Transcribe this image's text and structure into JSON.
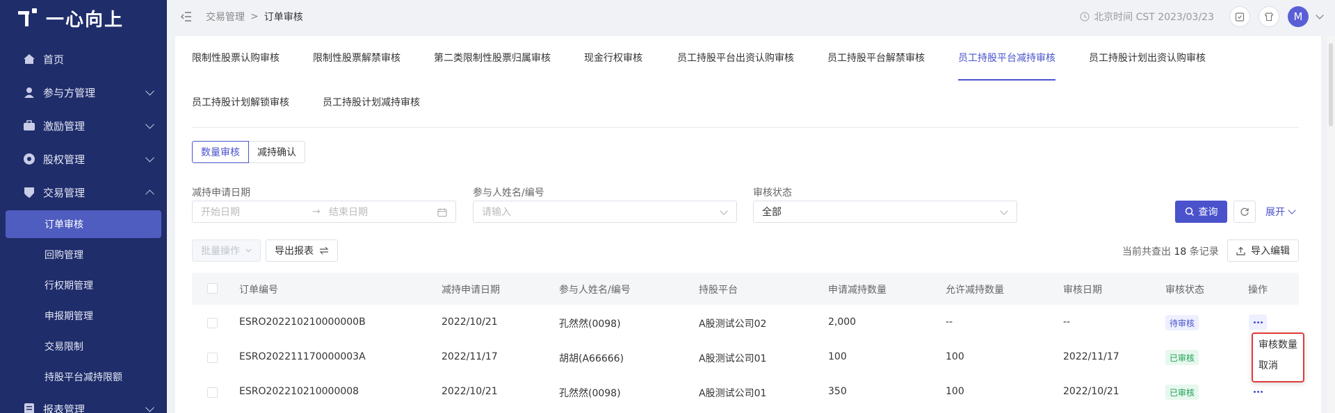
{
  "brand": {
    "name": "一心向上"
  },
  "sidebar": {
    "items": [
      {
        "label": "首页",
        "icon": "home-icon"
      },
      {
        "label": "参与方管理",
        "icon": "participant-icon",
        "expandable": true
      },
      {
        "label": "激励管理",
        "icon": "incentive-icon",
        "expandable": true
      },
      {
        "label": "股权管理",
        "icon": "equity-icon",
        "expandable": true
      },
      {
        "label": "交易管理",
        "icon": "trade-icon",
        "expandable": true,
        "expanded": true
      },
      {
        "label": "报表管理",
        "icon": "report-icon",
        "expandable": true
      }
    ],
    "sub_items": [
      "订单审核",
      "回购管理",
      "行权期管理",
      "申报期管理",
      "交易限制",
      "持股平台减持限额"
    ],
    "active_sub": "订单审核"
  },
  "header": {
    "breadcrumb": [
      "交易管理",
      "订单审核"
    ],
    "time": "北京时间 CST 2023/03/23",
    "avatar": "M"
  },
  "tabs": [
    "限制性股票认购审核",
    "限制性股票解禁审核",
    "第二类限制性股票归属审核",
    "现金行权审核",
    "员工持股平台出资认购审核",
    "员工持股平台解禁审核",
    "员工持股平台减持审核",
    "员工持股计划出资认购审核",
    "员工持股计划解锁审核",
    "员工持股计划减持审核"
  ],
  "active_tab": "员工持股平台减持审核",
  "segments": {
    "quantity": "数量审核",
    "confirm": "减持确认"
  },
  "filters": {
    "date_label": "减持申请日期",
    "start_placeholder": "开始日期",
    "end_placeholder": "结束日期",
    "person_label": "参与人姓名/编号",
    "person_placeholder": "请输入",
    "status_label": "审核状态",
    "status_value": "全部"
  },
  "actions": {
    "query": "查询",
    "expand": "展开",
    "batch": "批量操作",
    "export": "导出报表",
    "import": "导入编辑",
    "count_prefix": "当前共查出",
    "count": "18",
    "count_suffix": "条记录"
  },
  "table": {
    "columns": [
      "订单编号",
      "减持申请日期",
      "参与人姓名/编号",
      "持股平台",
      "申请减持数量",
      "允许减持数量",
      "审核日期",
      "审核状态",
      "操作"
    ],
    "rows": [
      [
        "ESRO202210210000000B",
        "2022/10/21",
        "孔然然(0098)",
        "A股测试公司02",
        "2,000",
        "--",
        "--",
        "待审核"
      ],
      [
        "ESRO202211170000003A",
        "2022/11/17",
        "胡胡(A66666)",
        "A股测试公司01",
        "100",
        "100",
        "2022/11/17",
        "已审核"
      ],
      [
        "ESRO202210210000008",
        "2022/10/21",
        "孔然然(0098)",
        "A股测试公司01",
        "350",
        "100",
        "2022/10/21",
        "已审核"
      ]
    ]
  },
  "popup_menu": [
    "审核数量",
    "取消"
  ],
  "colors": {
    "sidebar": "#1f2d6b",
    "accent": "#4a52cc",
    "popup_border": "#e03a3a"
  }
}
